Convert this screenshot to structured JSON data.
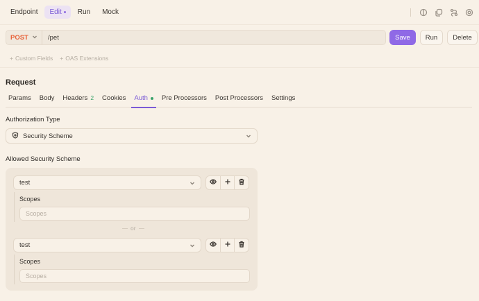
{
  "topbar": {
    "tabs": [
      {
        "label": "Endpoint"
      },
      {
        "label": "Edit"
      },
      {
        "label": "Run"
      },
      {
        "label": "Mock"
      }
    ],
    "icons": [
      "theme-icon",
      "copy-icon",
      "share-icon",
      "settings-icon"
    ]
  },
  "request": {
    "method": "POST",
    "path": "/pet",
    "save_label": "Save",
    "run_label": "Run",
    "delete_label": "Delete",
    "method_color": "#e8623a",
    "accent": "#8f69e6"
  },
  "extensions": {
    "custom_fields": "Custom Fields",
    "oas_extensions": "OAS Extensions"
  },
  "section": {
    "title": "Request",
    "tabs": [
      {
        "label": "Params"
      },
      {
        "label": "Body"
      },
      {
        "label": "Headers",
        "badge": "2"
      },
      {
        "label": "Cookies"
      },
      {
        "label": "Auth"
      },
      {
        "label": "Pre Processors"
      },
      {
        "label": "Post Processors"
      },
      {
        "label": "Settings"
      }
    ]
  },
  "auth": {
    "type_label": "Authorization Type",
    "type_value": "Security Scheme",
    "allowed_label": "Allowed Security Scheme",
    "schemes": [
      {
        "value": "test",
        "scopes_label": "Scopes",
        "scopes_placeholder": "Scopes"
      },
      {
        "value": "test",
        "scopes_label": "Scopes",
        "scopes_placeholder": "Scopes"
      }
    ],
    "or_label": "or"
  }
}
